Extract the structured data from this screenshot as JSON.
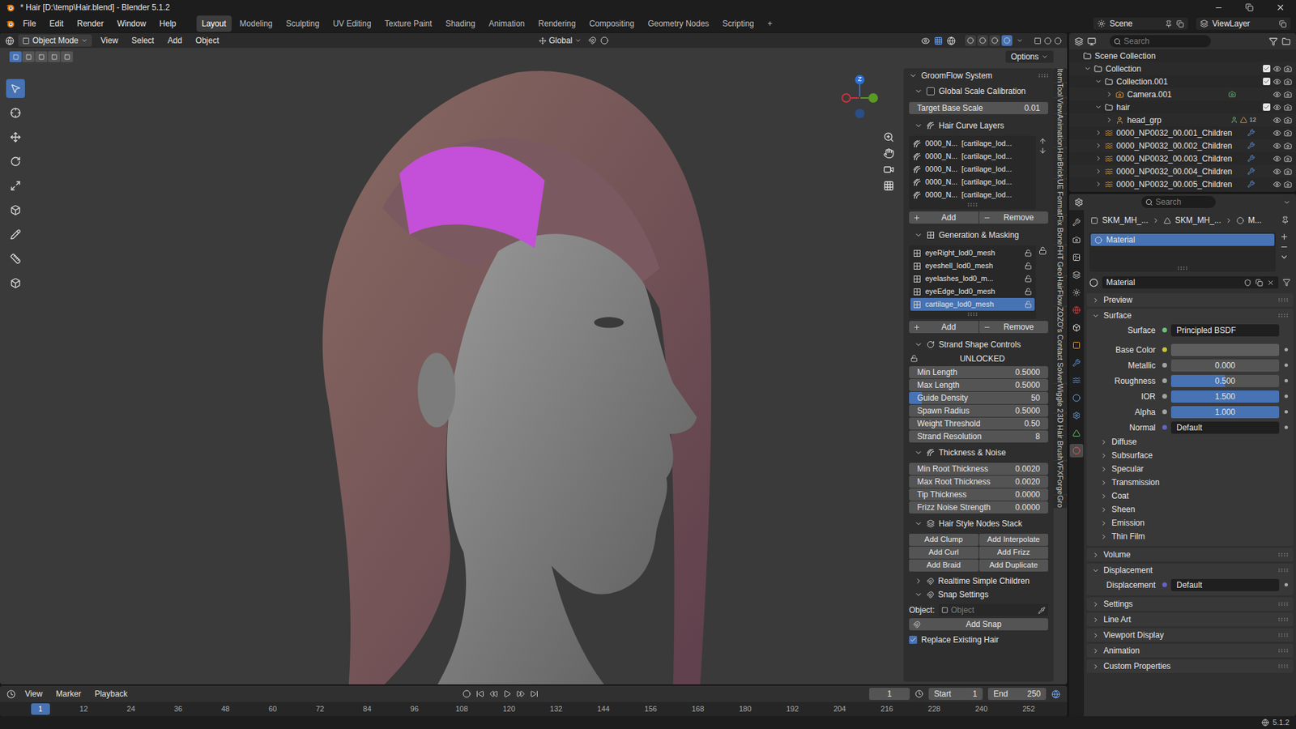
{
  "window": {
    "title": "* Hair [D:\\temp\\Hair.blend] - Blender 5.1.2"
  },
  "menu": [
    "File",
    "Edit",
    "Render",
    "Window",
    "Help"
  ],
  "workspaces": [
    {
      "label": "Layout",
      "selected": true
    },
    {
      "label": "Modeling",
      "selected": false
    },
    {
      "label": "Sculpting",
      "selected": false
    },
    {
      "label": "UV Editing",
      "selected": false
    },
    {
      "label": "Texture Paint",
      "selected": false
    },
    {
      "label": "Shading",
      "selected": false
    },
    {
      "label": "Animation",
      "selected": false
    },
    {
      "label": "Rendering",
      "selected": false
    },
    {
      "label": "Compositing",
      "selected": false
    },
    {
      "label": "Geometry Nodes",
      "selected": false
    },
    {
      "label": "Scripting",
      "selected": false
    },
    {
      "label": "+",
      "selected": false
    }
  ],
  "top_right": {
    "scene": "Scene",
    "view_layer": "ViewLayer"
  },
  "viewport_header": {
    "mode": "Object Mode",
    "menus": [
      "View",
      "Select",
      "Add",
      "Object"
    ],
    "orientation": "Global",
    "options": "Options",
    "select_modes": [
      {
        "selected": true
      },
      {
        "selected": false
      },
      {
        "selected": false
      },
      {
        "selected": false
      },
      {
        "selected": false
      }
    ],
    "shading_modes": [
      {
        "selected": false
      },
      {
        "selected": false
      },
      {
        "selected": false
      },
      {
        "selected": true
      }
    ]
  },
  "tools": [
    {
      "selected": true
    },
    {
      "selected": false
    },
    {
      "selected": false
    },
    {
      "selected": false
    },
    {
      "selected": false
    },
    {
      "selected": false
    },
    {
      "selected": false
    },
    {
      "selected": false
    },
    {
      "selected": false
    }
  ],
  "gizmo": {
    "axis_label": "Z"
  },
  "npanel": {
    "title": "GroomFlow System",
    "scale": {
      "label": "Global Scale Calibration",
      "checked": false,
      "field_label": "Target Base Scale",
      "value": "0.01"
    },
    "curve_layers": {
      "label": "Hair Curve Layers",
      "expanded": true,
      "add": "Add",
      "remove": "Remove",
      "items": [
        {
          "name": "0000_N...",
          "target": "[cartilage_lod...",
          "selected": false
        },
        {
          "name": "0000_N...",
          "target": "[cartilage_lod...",
          "selected": false
        },
        {
          "name": "0000_N...",
          "target": "[cartilage_lod...",
          "selected": false
        },
        {
          "name": "0000_N...",
          "target": "[cartilage_lod...",
          "selected": false
        },
        {
          "name": "0000_N...",
          "target": "[cartilage_lod...",
          "selected": false
        }
      ]
    },
    "masking": {
      "label": "Generation & Masking",
      "expanded": true,
      "add": "Add",
      "remove": "Remove",
      "items": [
        {
          "name": "eyeRight_lod0_mesh",
          "selected": false,
          "locked": false
        },
        {
          "name": "eyeshell_lod0_mesh",
          "selected": false,
          "locked": false
        },
        {
          "name": "eyelashes_lod0_m...",
          "selected": false,
          "locked": false
        },
        {
          "name": "eyeEdge_lod0_mesh",
          "selected": false,
          "locked": false
        },
        {
          "name": "cartilage_lod0_mesh",
          "selected": true,
          "locked": false
        }
      ]
    },
    "shape": {
      "label": "Strand Shape Controls",
      "expanded": true,
      "lock_state": "UNLOCKED",
      "locked": false,
      "fields": [
        {
          "label": "Min Length",
          "value": "0.5000",
          "kind": "number",
          "level": 0
        },
        {
          "label": "Max Length",
          "value": "0.5000",
          "kind": "number",
          "level": 0
        },
        {
          "label": "Guide Density",
          "value": "50",
          "kind": "slider",
          "level": 0.09
        },
        {
          "label": "Spawn Radius",
          "value": "0.5000",
          "kind": "number",
          "level": 0
        },
        {
          "label": "Weight Threshold",
          "value": "0.50",
          "kind": "number",
          "level": 0
        },
        {
          "label": "Strand Resolution",
          "value": "8",
          "kind": "number",
          "level": 0
        }
      ]
    },
    "thickness": {
      "label": "Thickness & Noise",
      "expanded": true,
      "fields": [
        {
          "label": "Min Root Thickness",
          "value": "0.0020",
          "kind": "number",
          "level": 0
        },
        {
          "label": "Max Root Thickness",
          "value": "0.0020",
          "kind": "number",
          "level": 0
        },
        {
          "label": "Tip Thickness",
          "value": "0.0000",
          "kind": "number",
          "level": 0
        },
        {
          "label": "Frizz Noise Strength",
          "value": "0.0000",
          "kind": "number",
          "level": 0
        }
      ]
    },
    "nodes": {
      "label": "Hair Style Nodes Stack",
      "expanded": true,
      "buttons": [
        "Add Clump",
        "Add Interpolate",
        "Add Curl",
        "Add Frizz",
        "Add Braid",
        "Add Duplicate"
      ]
    },
    "subpanels": [
      {
        "label": "Realtime Simple Children",
        "expanded": false
      },
      {
        "label": "Snap Settings",
        "expanded": true
      }
    ],
    "snap": {
      "object_label": "Object:",
      "object_placeholder": "Object",
      "button": "Add Snap",
      "replace": {
        "label": "Replace Existing Hair",
        "checked": true
      }
    }
  },
  "side_tabs": [
    "Item",
    "Tool",
    "View",
    "Animation",
    "HairBrick",
    "UE Format",
    "Fix Bone",
    "FHT Geo",
    "HairFlow",
    "ZOZO's Contact Solver",
    "Wiggle 2",
    "3D Hair Brush",
    "VFXForge",
    "Gro"
  ],
  "outliner": {
    "search_placeholder": "Search",
    "rows": [
      {
        "name": "Scene Collection",
        "kind": "scene",
        "depth": 0,
        "expanded": true,
        "checkable": false,
        "checked": false,
        "badge": ""
      },
      {
        "name": "Collection",
        "kind": "collection",
        "depth": 1,
        "expanded": true,
        "checkable": true,
        "checked": true,
        "badge": ""
      },
      {
        "name": "Collection.001",
        "kind": "collection",
        "depth": 2,
        "expanded": true,
        "checkable": true,
        "checked": true,
        "badge": ""
      },
      {
        "name": "Camera.001",
        "kind": "camera",
        "depth": 3,
        "expanded": false,
        "checkable": false,
        "checked": false,
        "badge": ""
      },
      {
        "name": "hair",
        "kind": "collection",
        "depth": 2,
        "expanded": true,
        "checkable": true,
        "checked": true,
        "badge": ""
      },
      {
        "name": "head_grp",
        "kind": "armature",
        "depth": 3,
        "expanded": false,
        "checkable": false,
        "checked": false,
        "badge": "12"
      },
      {
        "name": "0000_NP0032_00.001_Children",
        "kind": "curves",
        "depth": 2,
        "expanded": false,
        "checkable": false,
        "checked": false,
        "badge": ""
      },
      {
        "name": "0000_NP0032_00.002_Children",
        "kind": "curves",
        "depth": 2,
        "expanded": false,
        "checkable": false,
        "checked": false,
        "badge": ""
      },
      {
        "name": "0000_NP0032_00.003_Children",
        "kind": "curves",
        "depth": 2,
        "expanded": false,
        "checkable": false,
        "checked": false,
        "badge": ""
      },
      {
        "name": "0000_NP0032_00.004_Children",
        "kind": "curves",
        "depth": 2,
        "expanded": false,
        "checkable": false,
        "checked": false,
        "badge": ""
      },
      {
        "name": "0000_NP0032_00.005_Children",
        "kind": "curves",
        "depth": 2,
        "expanded": false,
        "checkable": false,
        "checked": false,
        "badge": ""
      }
    ]
  },
  "properties": {
    "search_placeholder": "Search",
    "tabs": [
      {
        "selected": false
      },
      {
        "selected": false
      },
      {
        "selected": false
      },
      {
        "selected": false
      },
      {
        "selected": false
      },
      {
        "selected": false
      },
      {
        "selected": false
      },
      {
        "selected": false
      },
      {
        "selected": false
      },
      {
        "selected": false
      },
      {
        "selected": false
      },
      {
        "selected": false
      },
      {
        "selected": false
      },
      {
        "selected": true
      }
    ],
    "breadcrumb": [
      "SKM_MH_...",
      "SKM_MH_...",
      "M..."
    ],
    "slots": [
      {
        "name": "Material",
        "selected": true
      }
    ],
    "material_name": "Material",
    "preview": {
      "label": "Preview",
      "expanded": false
    },
    "surface": {
      "label": "Surface",
      "expanded": true,
      "shader_label": "Surface",
      "shader": "Principled BSDF",
      "inputs": [
        {
          "label": "Base Color",
          "kind": "color",
          "value": "",
          "level": 0,
          "color": "#5e5e5e",
          "socket_color": "#c7c729"
        },
        {
          "label": "Metallic",
          "kind": "slider",
          "value": "0.000",
          "level": 0,
          "color": "",
          "socket_color": "#a1a1a1"
        },
        {
          "label": "Roughness",
          "kind": "slider",
          "value": "0.500",
          "level": 0.5,
          "color": "",
          "socket_color": "#a1a1a1"
        },
        {
          "label": "IOR",
          "kind": "slider",
          "value": "1.500",
          "level": 1,
          "color": "",
          "socket_color": "#a1a1a1"
        },
        {
          "label": "Alpha",
          "kind": "slider",
          "value": "1.000",
          "level": 1,
          "color": "",
          "socket_color": "#a1a1a1"
        },
        {
          "label": "Normal",
          "kind": "link",
          "value": "Default",
          "level": 0,
          "color": "",
          "socket_color": "#6363c7"
        }
      ],
      "subpanels": [
        {
          "label": "Diffuse",
          "expanded": false
        },
        {
          "label": "Subsurface",
          "expanded": false
        },
        {
          "label": "Specular",
          "expanded": false
        },
        {
          "label": "Transmission",
          "expanded": false
        },
        {
          "label": "Coat",
          "expanded": false
        },
        {
          "label": "Sheen",
          "expanded": false
        },
        {
          "label": "Emission",
          "expanded": false
        },
        {
          "label": "Thin Film",
          "expanded": false
        }
      ]
    },
    "volume": {
      "label": "Volume",
      "expanded": false
    },
    "displacement": {
      "label": "Displacement",
      "expanded": true,
      "input": {
        "label": "Displacement",
        "value": "Default",
        "socket_color": "#6363c7"
      }
    },
    "bottom_panels": [
      {
        "label": "Settings",
        "expanded": false
      },
      {
        "label": "Line Art",
        "expanded": false
      },
      {
        "label": "Viewport Display",
        "expanded": false
      },
      {
        "label": "Animation",
        "expanded": false
      },
      {
        "label": "Custom Properties",
        "expanded": false
      }
    ]
  },
  "timeline": {
    "menus": [
      "View",
      "Marker",
      "Playback"
    ],
    "current_frame": "1",
    "start_label": "Start",
    "start": "1",
    "end_label": "End",
    "end": "250",
    "ticks": [
      "1",
      "12",
      "24",
      "36",
      "48",
      "60",
      "72",
      "84",
      "96",
      "108",
      "120",
      "132",
      "144",
      "156",
      "168",
      "180",
      "192",
      "204",
      "216",
      "228",
      "240",
      "252"
    ]
  },
  "status_bar": {
    "version": "5.1.2"
  }
}
